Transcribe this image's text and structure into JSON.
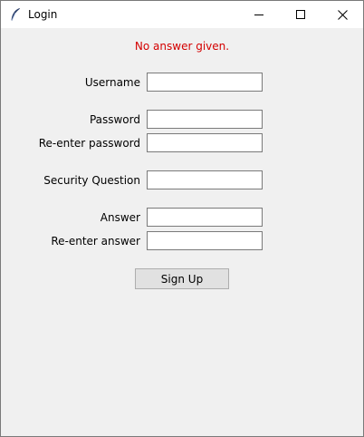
{
  "window": {
    "title": "Login",
    "icon": "feather-icon",
    "controls": [
      "minimize-icon",
      "maximize-icon",
      "close-icon"
    ]
  },
  "colors": {
    "error": "#d40000",
    "background": "#f0f0f0"
  },
  "status": {
    "error_message": "No answer given."
  },
  "form": {
    "username": {
      "label": "Username",
      "value": ""
    },
    "password": {
      "label": "Password",
      "value": ""
    },
    "reenter_password": {
      "label": "Re-enter password",
      "value": ""
    },
    "security_question": {
      "label": "Security Question",
      "value": ""
    },
    "answer": {
      "label": "Answer",
      "value": ""
    },
    "reenter_answer": {
      "label": "Re-enter answer",
      "value": ""
    }
  },
  "actions": {
    "signup_label": "Sign Up"
  }
}
